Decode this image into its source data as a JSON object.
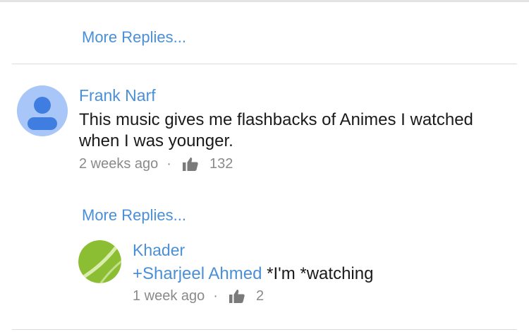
{
  "thread": {
    "more_replies_top": "More Replies...",
    "comments": [
      {
        "author": "Frank Narf",
        "text": "This music gives me flashbacks of Animes I watched when I was younger.",
        "time": "2 weeks ago",
        "separator": "·",
        "likes": "132",
        "avatar_icon": "default-person-icon",
        "more_replies": "More Replies..."
      }
    ],
    "replies": [
      {
        "author": "Khader",
        "mention": "+Sharjeel Ahmed",
        "text": " *I'm *watching",
        "time": "1 week ago",
        "separator": "·",
        "likes": "2",
        "avatar_icon": "tennis-ball-avatar"
      }
    ]
  },
  "colors": {
    "link": "#4a8fd8",
    "text": "#1a1a1a",
    "meta": "#8a8a8a",
    "divider": "#dcdcdc",
    "avatar_bg": "#a8c7f8",
    "avatar_person": "#3f7ee0",
    "khader_avatar": "#8cbe34"
  }
}
